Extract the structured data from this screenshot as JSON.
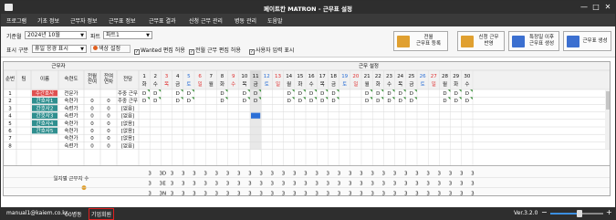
{
  "window": {
    "title": "페이트칸 MATRON - 근무표 설정",
    "minimize": "—",
    "maximize": "□",
    "close": "✕"
  },
  "menu": [
    "프로그램",
    "기초 정보",
    "근무자 정보",
    "근무표 정보",
    "근무표 결과",
    "신청 근무 관리",
    "병동 관리",
    "도움말"
  ],
  "toolbar": {
    "base_month_label": "기준월",
    "base_month_value": "2024년 10월",
    "part_label": "파트",
    "part_value": "파트1",
    "display_label": "표시 구분",
    "display_value": "휴일 응경 표시",
    "color_button": "색상 설정",
    "wanted_toggle": "Wanted 편집 허용",
    "wanted_checked": true,
    "prev_month_toggle": "전월 근무 편집 허용",
    "prev_month_checked": true,
    "user_input_toggle": "사용자 입력 표시",
    "user_input_checked": true,
    "buttons": [
      {
        "label": "전월\n근무표 등록",
        "icon": "import-schedule-icon",
        "color": "#e0a030"
      },
      {
        "label": "신청 근무\n반영",
        "icon": "apply-request-icon",
        "color": "#e0a030"
      },
      {
        "label": "특정일 이후\n근무표 생성",
        "icon": "generate-after-date-icon",
        "color": "#3b6fd0"
      },
      {
        "label": "근무표 생성",
        "icon": "generate-schedule-icon",
        "color": "#3b6fd0"
      }
    ]
  },
  "grid": {
    "header_worker": "근무자",
    "header_schedule": "근무 설정",
    "columns": [
      "순번",
      "팀",
      "이름",
      "숙련도",
      "전월\n잔여",
      "잔여\n연차",
      "전담"
    ],
    "days": [
      {
        "d": "1",
        "w": "화"
      },
      {
        "d": "2",
        "w": "수"
      },
      {
        "d": "3",
        "w": "목"
      },
      {
        "d": "4",
        "w": "금"
      },
      {
        "d": "5",
        "w": "토"
      },
      {
        "d": "6",
        "w": "일"
      },
      {
        "d": "7",
        "w": "월"
      },
      {
        "d": "8",
        "w": "화"
      },
      {
        "d": "9",
        "w": "수"
      },
      {
        "d": "10",
        "w": "목"
      },
      {
        "d": "11",
        "w": "금"
      },
      {
        "d": "12",
        "w": "토"
      },
      {
        "d": "13",
        "w": "일"
      },
      {
        "d": "14",
        "w": "월"
      },
      {
        "d": "15",
        "w": "화"
      },
      {
        "d": "16",
        "w": "수"
      },
      {
        "d": "17",
        "w": "목"
      },
      {
        "d": "18",
        "w": "금"
      },
      {
        "d": "19",
        "w": "토"
      },
      {
        "d": "20",
        "w": "일"
      },
      {
        "d": "21",
        "w": "월"
      },
      {
        "d": "22",
        "w": "화"
      },
      {
        "d": "23",
        "w": "수"
      },
      {
        "d": "24",
        "w": "목"
      },
      {
        "d": "25",
        "w": "금"
      },
      {
        "d": "26",
        "w": "토"
      },
      {
        "d": "27",
        "w": "일"
      },
      {
        "d": "28",
        "w": "월"
      },
      {
        "d": "29",
        "w": "화"
      },
      {
        "d": "30",
        "w": "수"
      }
    ],
    "red_days": [
      "3",
      "6",
      "9",
      "13",
      "20",
      "27"
    ],
    "blue_days": [
      "5",
      "12",
      "19",
      "26"
    ],
    "rows": [
      {
        "no": "1",
        "name": "수간호사",
        "skill": "전문가",
        "prev": "",
        "annual": "",
        "duty": "주중 근무",
        "name_color": "#e05050",
        "schedule": [
          "D",
          "D",
          "",
          "D",
          "D",
          "",
          "",
          "D",
          "",
          "D",
          "D",
          "",
          "",
          "D",
          "D",
          "D",
          "D",
          "D",
          "",
          "",
          "D",
          "D",
          "D",
          "D",
          "D",
          "",
          "",
          "D",
          "D",
          "D"
        ]
      },
      {
        "no": "2",
        "name": "간호사1",
        "skill": "숙련가",
        "prev": "0",
        "annual": "0",
        "duty": "주중 근무",
        "name_color": "#2f8f8f",
        "schedule": [
          "D",
          "D",
          "",
          "D",
          "D",
          "",
          "",
          "D",
          "",
          "D",
          "D",
          "",
          "",
          "D",
          "D",
          "D",
          "D",
          "D",
          "",
          "",
          "D",
          "D",
          "D",
          "D",
          "D",
          "",
          "",
          "D",
          "D",
          "D"
        ]
      },
      {
        "no": "3",
        "name": "간호사2",
        "skill": "숙련가",
        "prev": "0",
        "annual": "0",
        "duty": "[없음]",
        "name_color": "#2f8f8f",
        "schedule": []
      },
      {
        "no": "4",
        "name": "간호사3",
        "skill": "숙련가",
        "prev": "0",
        "annual": "0",
        "duty": "[없음]",
        "name_color": "#2f8f8f",
        "schedule": []
      },
      {
        "no": "5",
        "name": "간호사4",
        "skill": "숙련가",
        "prev": "0",
        "annual": "0",
        "duty": "[없음]",
        "name_color": "#2f8f8f",
        "schedule": []
      },
      {
        "no": "6",
        "name": "간호사5",
        "skill": "숙련가",
        "prev": "0",
        "annual": "0",
        "duty": "[없음]",
        "name_color": "#2f8f8f",
        "schedule": []
      },
      {
        "no": "7",
        "name": "",
        "skill": "숙련가",
        "prev": "0",
        "annual": "0",
        "duty": "[없음]",
        "name_color": "",
        "schedule": []
      },
      {
        "no": "8",
        "name": "",
        "skill": "숙련가",
        "prev": "0",
        "annual": "0",
        "duty": "[없음]",
        "name_color": "",
        "schedule": []
      }
    ],
    "summary_label": "일자별 근무자 수",
    "summary_rows": [
      {
        "code": "D",
        "values": [
          "3",
          "3",
          "3",
          "3",
          "3",
          "3",
          "3",
          "3",
          "3",
          "3",
          "3",
          "3",
          "3",
          "3",
          "3",
          "3",
          "3",
          "3",
          "3",
          "3",
          "3",
          "3",
          "3",
          "3",
          "3",
          "3",
          "3",
          "3",
          "3",
          "3"
        ]
      },
      {
        "code": "E",
        "values": [
          "3",
          "3",
          "3",
          "3",
          "3",
          "3",
          "3",
          "3",
          "3",
          "3",
          "3",
          "3",
          "3",
          "3",
          "3",
          "3",
          "3",
          "3",
          "3",
          "3",
          "3",
          "3",
          "3",
          "3",
          "3",
          "3",
          "3",
          "3",
          "3",
          "3"
        ]
      },
      {
        "code": "N",
        "values": [
          "3",
          "3",
          "3",
          "3",
          "3",
          "3",
          "3",
          "3",
          "3",
          "3",
          "3",
          "3",
          "3",
          "3",
          "3",
          "3",
          "3",
          "3",
          "3",
          "3",
          "3",
          "3",
          "3",
          "3",
          "3",
          "3",
          "3",
          "3",
          "3",
          "3"
        ]
      }
    ]
  },
  "status": {
    "email": "manual1@kaiem.co.kr",
    "ward": "00병동",
    "license": "기업회원",
    "version": "Ver.3.2.0",
    "zoom_minus": "−",
    "zoom_plus": "+",
    "zoom_level": 0.55,
    "license_border": "#e02020"
  }
}
